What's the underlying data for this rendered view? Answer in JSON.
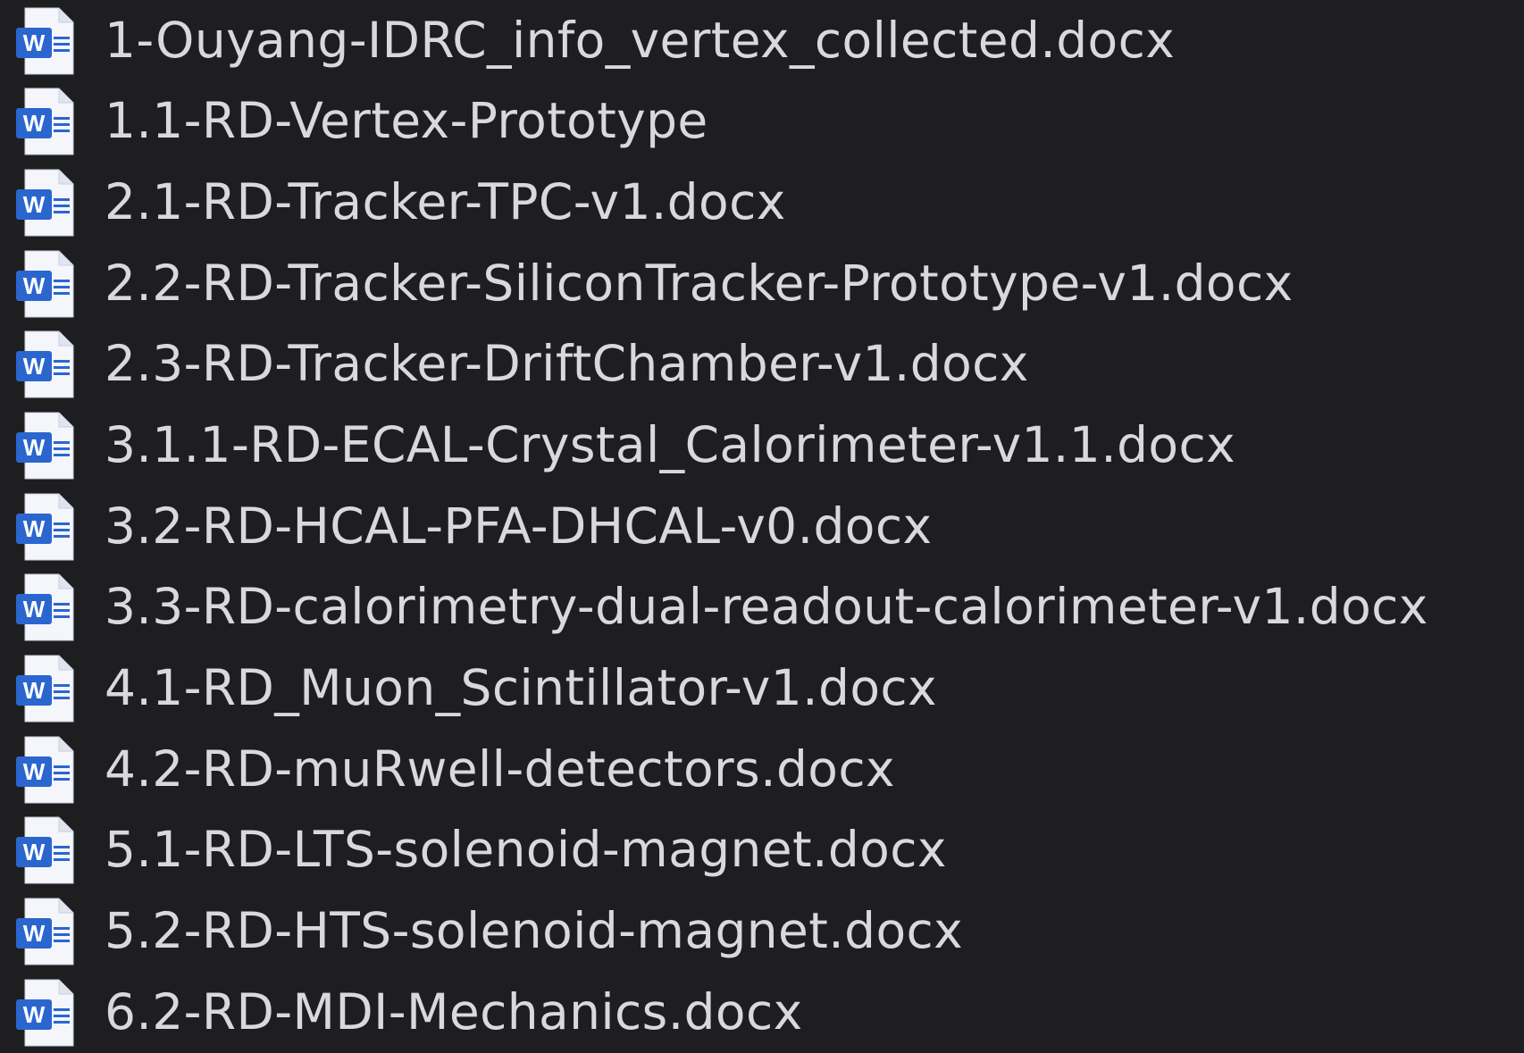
{
  "file_list": {
    "icon": "word-document-icon",
    "icon_letter": "W",
    "colors": {
      "background": "#1e1e20",
      "text": "#d9d9dc",
      "icon_blue": "#2b66cf",
      "icon_page": "#f4f6fb"
    },
    "items": [
      {
        "name": "1-Ouyang-IDRC_info_vertex_collected.docx"
      },
      {
        "name": "1.1-RD-Vertex-Prototype"
      },
      {
        "name": "2.1-RD-Tracker-TPC-v1.docx"
      },
      {
        "name": "2.2-RD-Tracker-SiliconTracker-Prototype-v1.docx"
      },
      {
        "name": "2.3-RD-Tracker-DriftChamber-v1.docx"
      },
      {
        "name": "3.1.1-RD-ECAL-Crystal_Calorimeter-v1.1.docx"
      },
      {
        "name": "3.2-RD-HCAL-PFA-DHCAL-v0.docx"
      },
      {
        "name": "3.3-RD-calorimetry-dual-readout-calorimeter-v1.docx"
      },
      {
        "name": "4.1-RD_Muon_Scintillator-v1.docx"
      },
      {
        "name": "4.2-RD-muRwell-detectors.docx"
      },
      {
        "name": "5.1-RD-LTS-solenoid-magnet.docx"
      },
      {
        "name": "5.2-RD-HTS-solenoid-magnet.docx"
      },
      {
        "name": "6.2-RD-MDI-Mechanics.docx"
      }
    ]
  }
}
